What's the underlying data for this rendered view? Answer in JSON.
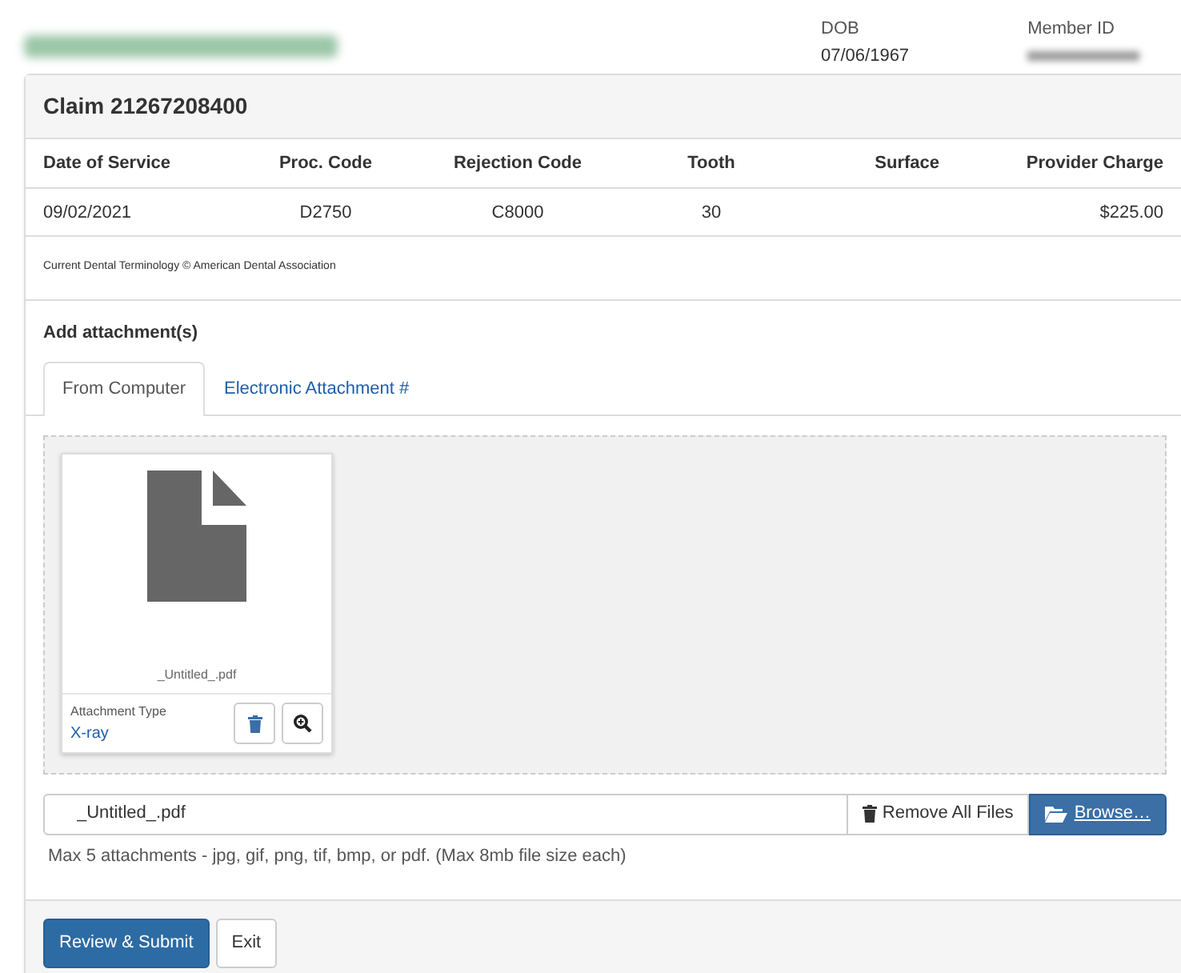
{
  "member": {
    "dob_label": "DOB",
    "dob": "07/06/1967",
    "member_id_label": "Member ID"
  },
  "claim": {
    "title": "Claim 21267208400",
    "columns": [
      "Date of Service",
      "Proc. Code",
      "Rejection Code",
      "Tooth",
      "Surface",
      "Provider Charge"
    ],
    "rows": [
      {
        "date_of_service": "09/02/2021",
        "proc_code": "D2750",
        "rejection_code": "C8000",
        "tooth": "30",
        "provider_charge": "$225.00"
      }
    ],
    "note": "Current Dental Terminology © American Dental Association"
  },
  "attachments": {
    "heading": "Add attachment(s)",
    "tabs": [
      {
        "label": "From Computer",
        "selected": true
      },
      {
        "label": "Electronic Attachment #",
        "selected": false
      }
    ],
    "files": [
      {
        "file_name": "_Untitled_.pdf",
        "type_label": "Attachment Type",
        "type_value": "X-ray"
      }
    ],
    "file_field": {
      "value": "_Untitled_.pdf"
    },
    "remove_all": "Remove All Files",
    "browse": "Browse…",
    "hint": "Max 5 attachments - jpg, gif, png, tif, bmp, or pdf. (Max 8mb file size each)"
  },
  "buttons": [
    {
      "label": "Review & Submit",
      "kind": "primary"
    },
    {
      "label": "Exit",
      "kind": "secondary"
    }
  ]
}
